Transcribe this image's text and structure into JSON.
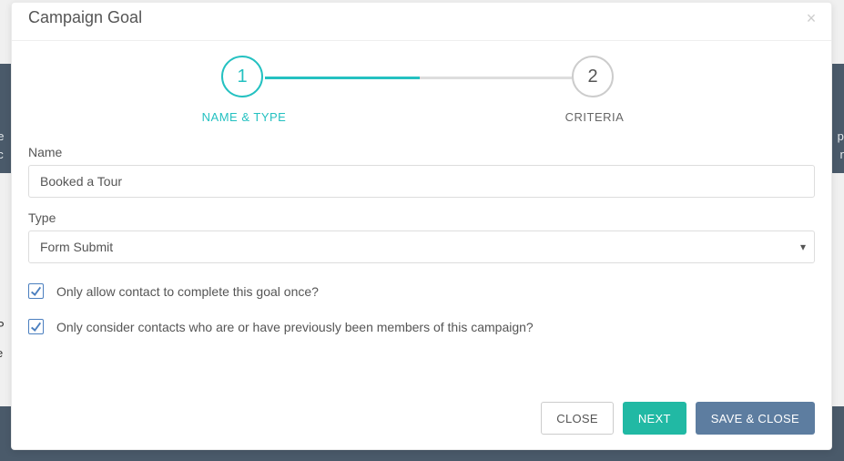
{
  "background": {
    "left_line1": "ne",
    "left_line2": "ac",
    "right_line1": "pla",
    "right_line2": "ne",
    "row_p": "P",
    "row_e": "e"
  },
  "modal": {
    "title": "Campaign Goal"
  },
  "stepper": {
    "step1_number": "1",
    "step1_label": "NAME & TYPE",
    "step2_number": "2",
    "step2_label": "CRITERIA"
  },
  "form": {
    "name_label": "Name",
    "name_value": "Booked a Tour",
    "type_label": "Type",
    "type_value": "Form Submit",
    "check1_label": "Only allow contact to complete this goal once?",
    "check2_label": "Only consider contacts who are or have previously been members of this campaign?"
  },
  "footer": {
    "close": "CLOSE",
    "next": "NEXT",
    "save_close": "SAVE & CLOSE"
  }
}
